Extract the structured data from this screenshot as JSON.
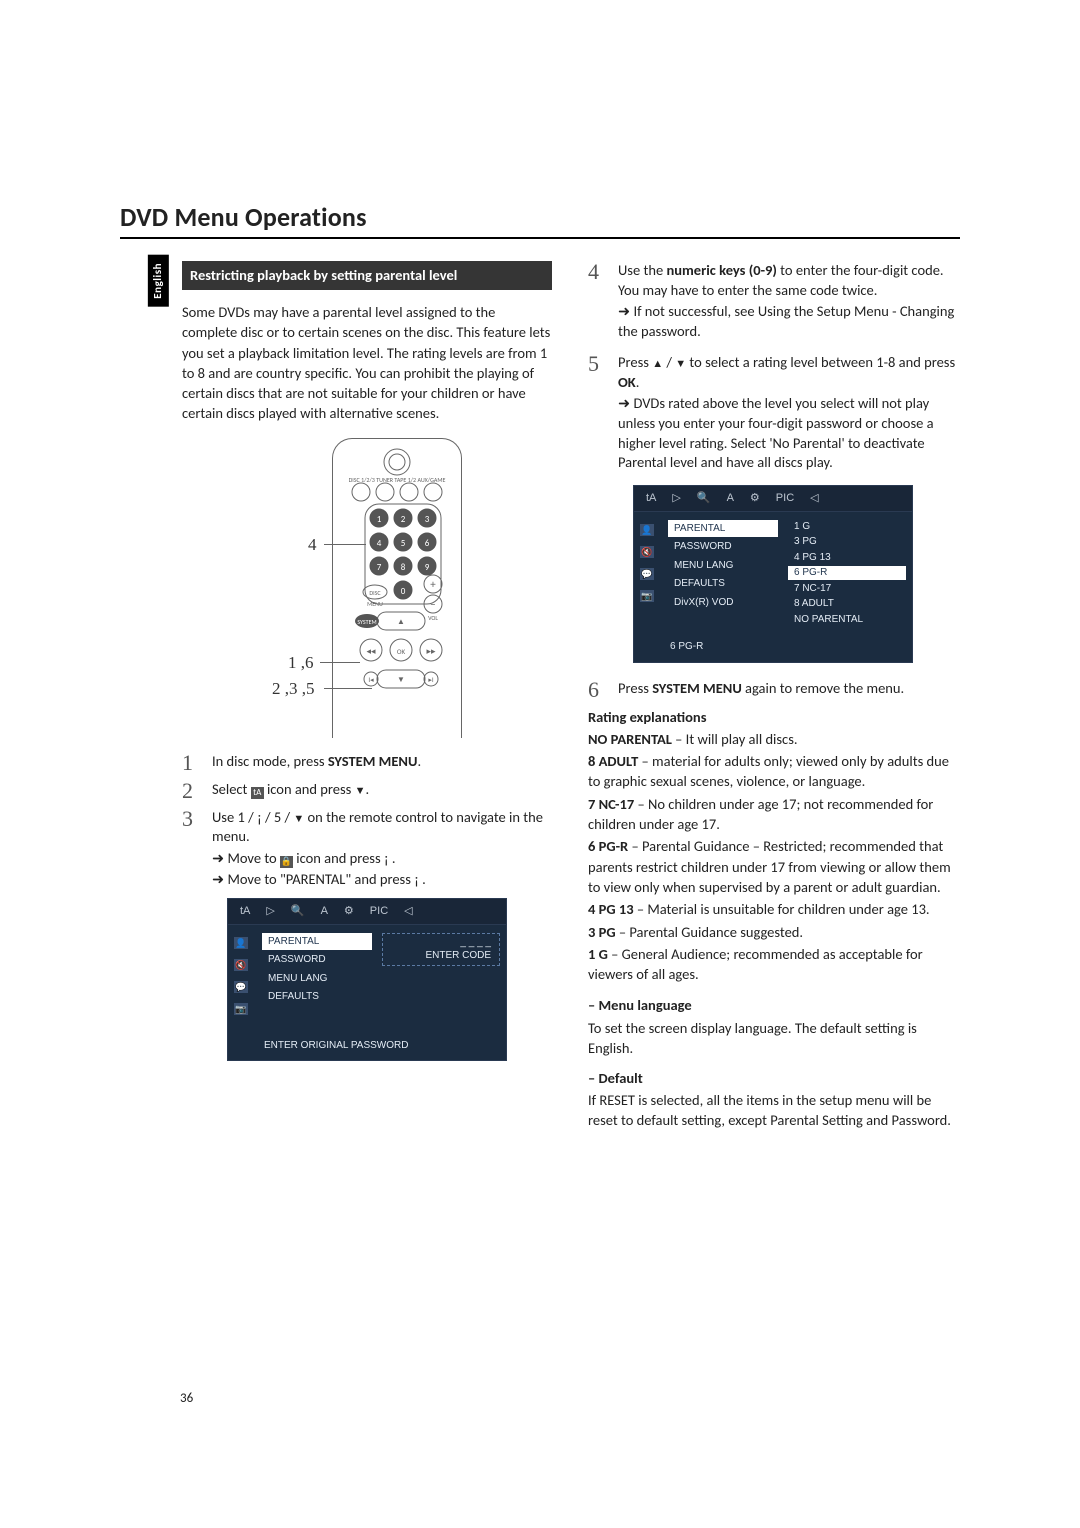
{
  "lang_tab": "English",
  "title": "DVD Menu Operations",
  "left": {
    "heading": "Restricting playback by setting parental level",
    "intro": "Some DVDs may have a parental level assigned to the complete disc or to certain scenes on the disc. This feature lets you set a playback limitation level. The rating levels are from 1 to 8 and are country specific. You can prohibit the playing of certain discs that are not suitable for your children or have certain discs played with alternative scenes.",
    "callouts": {
      "c4": "4",
      "c16": "1 ,6",
      "c235": "2 ,3 ,5"
    },
    "step1": {
      "n": "1",
      "t1": "In disc mode, press ",
      "kw": "SYSTEM MENU",
      "t2": "."
    },
    "step2": {
      "n": "2",
      "t1": "Select ",
      "t2": " icon and press ",
      "t3": "."
    },
    "step3": {
      "n": "3",
      "t1": "Use 1   /  ¡   / 5   /  ",
      "t2": " on the remote control to navigate in the menu.",
      "s1a": "Move to ",
      "s1b": " icon and press ¡   .",
      "s2": "Move to \"PARENTAL\" and press ¡   ."
    },
    "osd1": {
      "mid": [
        "PARENTAL",
        "PASSWORD",
        "MENU LANG",
        "DEFAULTS"
      ],
      "right_box": "_ _ _ _\nENTER CODE",
      "footer": "ENTER ORIGINAL PASSWORD"
    }
  },
  "right": {
    "step4": {
      "n": "4",
      "t1": "Use the ",
      "kw": "numeric keys (0-9)",
      "t2": " to enter the four-digit code. You may have to enter the same code twice.",
      "s1": "If not successful, see Using the Setup Menu - Changing the password."
    },
    "step5": {
      "n": "5",
      "t1": "Press ",
      "t2": " / ",
      "t3": " to select a rating level between 1-8 and press ",
      "kw": "OK",
      "t4": ".",
      "s1": "DVDs rated above the level you select will not play unless you enter your four-digit password or choose a higher level rating. Select 'No Parental' to deactivate Parental level and have all discs play."
    },
    "osd2": {
      "mid": [
        "PARENTAL",
        "PASSWORD",
        "MENU LANG",
        "DEFAULTS",
        "DivX(R) VOD"
      ],
      "opts": [
        "1 G",
        "3 PG",
        "4 PG 13",
        "6 PG-R",
        "7 NC-17",
        "8 ADULT",
        "NO PARENTAL"
      ],
      "selected": "6 PG-R",
      "footer": "6 PG-R"
    },
    "step6": {
      "n": "6",
      "t1": "Press ",
      "kw": "SYSTEM MENU",
      "t2": " again to remove the menu."
    },
    "rating": {
      "heading": "Rating explanations",
      "items": {
        "no_parental_l": "NO PARENTAL",
        "no_parental_t": " – It will play all discs.",
        "adult_l": "8 ADULT",
        "adult_t": " – material for adults only; viewed only by adults due to graphic sexual scenes, violence, or language.",
        "nc17_l": "7 NC-17",
        "nc17_t": " – No children under age 17; not recommended for children under age 17.",
        "pgr_l": "6 PG-R",
        "pgr_t": " – Parental Guidance – Restricted; recommended that parents restrict children under 17 from viewing or allow them to view only when supervised by a parent or adult guardian.",
        "pg13_l": "4 PG 13",
        "pg13_t": " – Material is unsuitable for children under age 13.",
        "pg_l": "3 PG",
        "pg_t": " – Parental Guidance suggested.",
        "g_l": "1 G",
        "g_t": " – General Audience; recommended as acceptable for viewers of all ages."
      }
    },
    "menulang": {
      "heading": "–  Menu language",
      "body": "To set the screen display language. The default setting is English."
    },
    "default": {
      "heading": "–  Default",
      "body": "If RESET is selected, all the items in the setup menu will be reset to default setting, except Parental Setting and Password."
    }
  },
  "page_num": "36",
  "osd_topbar_icons": [
    "tA",
    "▷",
    "🔍",
    "A",
    "⚙",
    "PIC",
    "◁"
  ]
}
